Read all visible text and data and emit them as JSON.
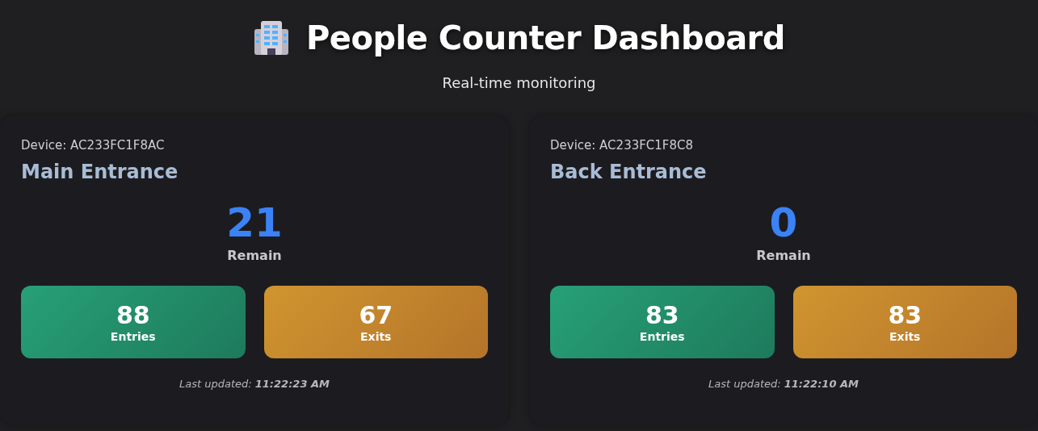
{
  "header": {
    "title": "People Counter Dashboard",
    "subtitle": "Real-time monitoring"
  },
  "devices": [
    {
      "device": "Device: AC233FC1F8AC",
      "name": "Main Entrance",
      "remain": "21",
      "remain_label": "Remain",
      "stats": [
        {
          "kind": "entries",
          "value": "88",
          "label": "Entries"
        },
        {
          "kind": "exits",
          "value": "67",
          "label": "Exits"
        }
      ],
      "updated": "Last updated: **11:22:23 AM**"
    },
    {
      "device": "Device: AC233FC1F8C8",
      "name": "Back Entrance",
      "remain": "0",
      "remain_label": "Remain",
      "stats": [
        {
          "kind": "entries",
          "value": "83",
          "label": "Entries"
        },
        {
          "kind": "exits",
          "value": "83",
          "label": "Exits"
        }
      ],
      "updated": "Last updated: **11:22:10 AM**"
    }
  ]
}
